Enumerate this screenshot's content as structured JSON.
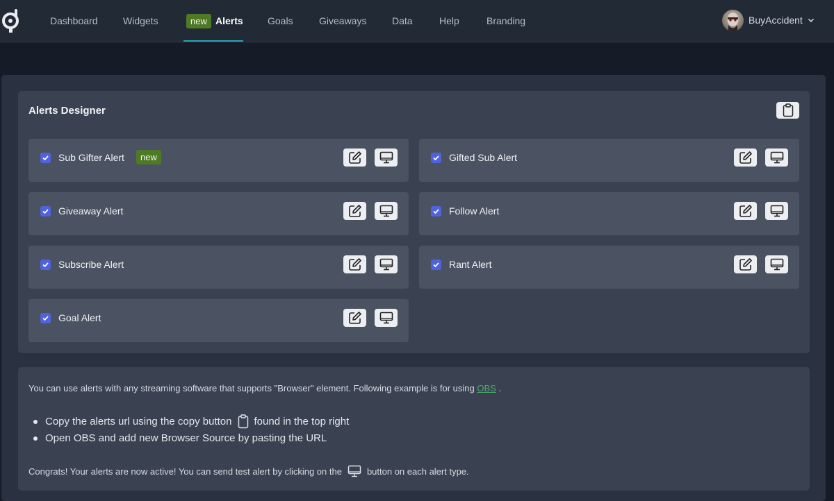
{
  "nav": {
    "items": [
      {
        "label": "Dashboard"
      },
      {
        "label": "Widgets"
      },
      {
        "label": "Alerts",
        "badge": "new",
        "active": true
      },
      {
        "label": "Goals"
      },
      {
        "label": "Giveaways"
      },
      {
        "label": "Data"
      },
      {
        "label": "Help"
      },
      {
        "label": "Branding"
      }
    ],
    "user": {
      "name": "BuyAccident"
    }
  },
  "designer": {
    "title": "Alerts Designer",
    "alerts": [
      {
        "label": "Sub Gifter Alert",
        "badge": "new",
        "checked": true
      },
      {
        "label": "Gifted Sub Alert",
        "checked": true
      },
      {
        "label": "Giveaway Alert",
        "checked": true
      },
      {
        "label": "Follow Alert",
        "checked": true
      },
      {
        "label": "Subscribe Alert",
        "checked": true
      },
      {
        "label": "Rant Alert",
        "checked": true
      },
      {
        "label": "Goal Alert",
        "checked": true
      }
    ]
  },
  "info": {
    "intro": "You can use alerts with any streaming software that supports \"Browser\" element. Following example is for using",
    "intro_link": "OBS",
    "intro_end": ".",
    "bullet1_before": "Copy the alerts url using the copy button",
    "bullet1_after": "found in the top right",
    "bullet2": "Open OBS and add new Browser Source by pasting the URL",
    "congrats_before": "Congrats! Your alerts are now active! You can send test alert by clicking on the",
    "congrats_after": "button on each alert type."
  },
  "colors": {
    "accent_checkbox": "#4f63e0",
    "badge_green": "#4f7a25",
    "link_green": "#4fa96b",
    "nav_underline": "#2aa0b4"
  },
  "icons": [
    "logo-icon",
    "chevron-down-icon",
    "clipboard-icon",
    "check-icon",
    "edit-icon",
    "monitor-icon"
  ]
}
